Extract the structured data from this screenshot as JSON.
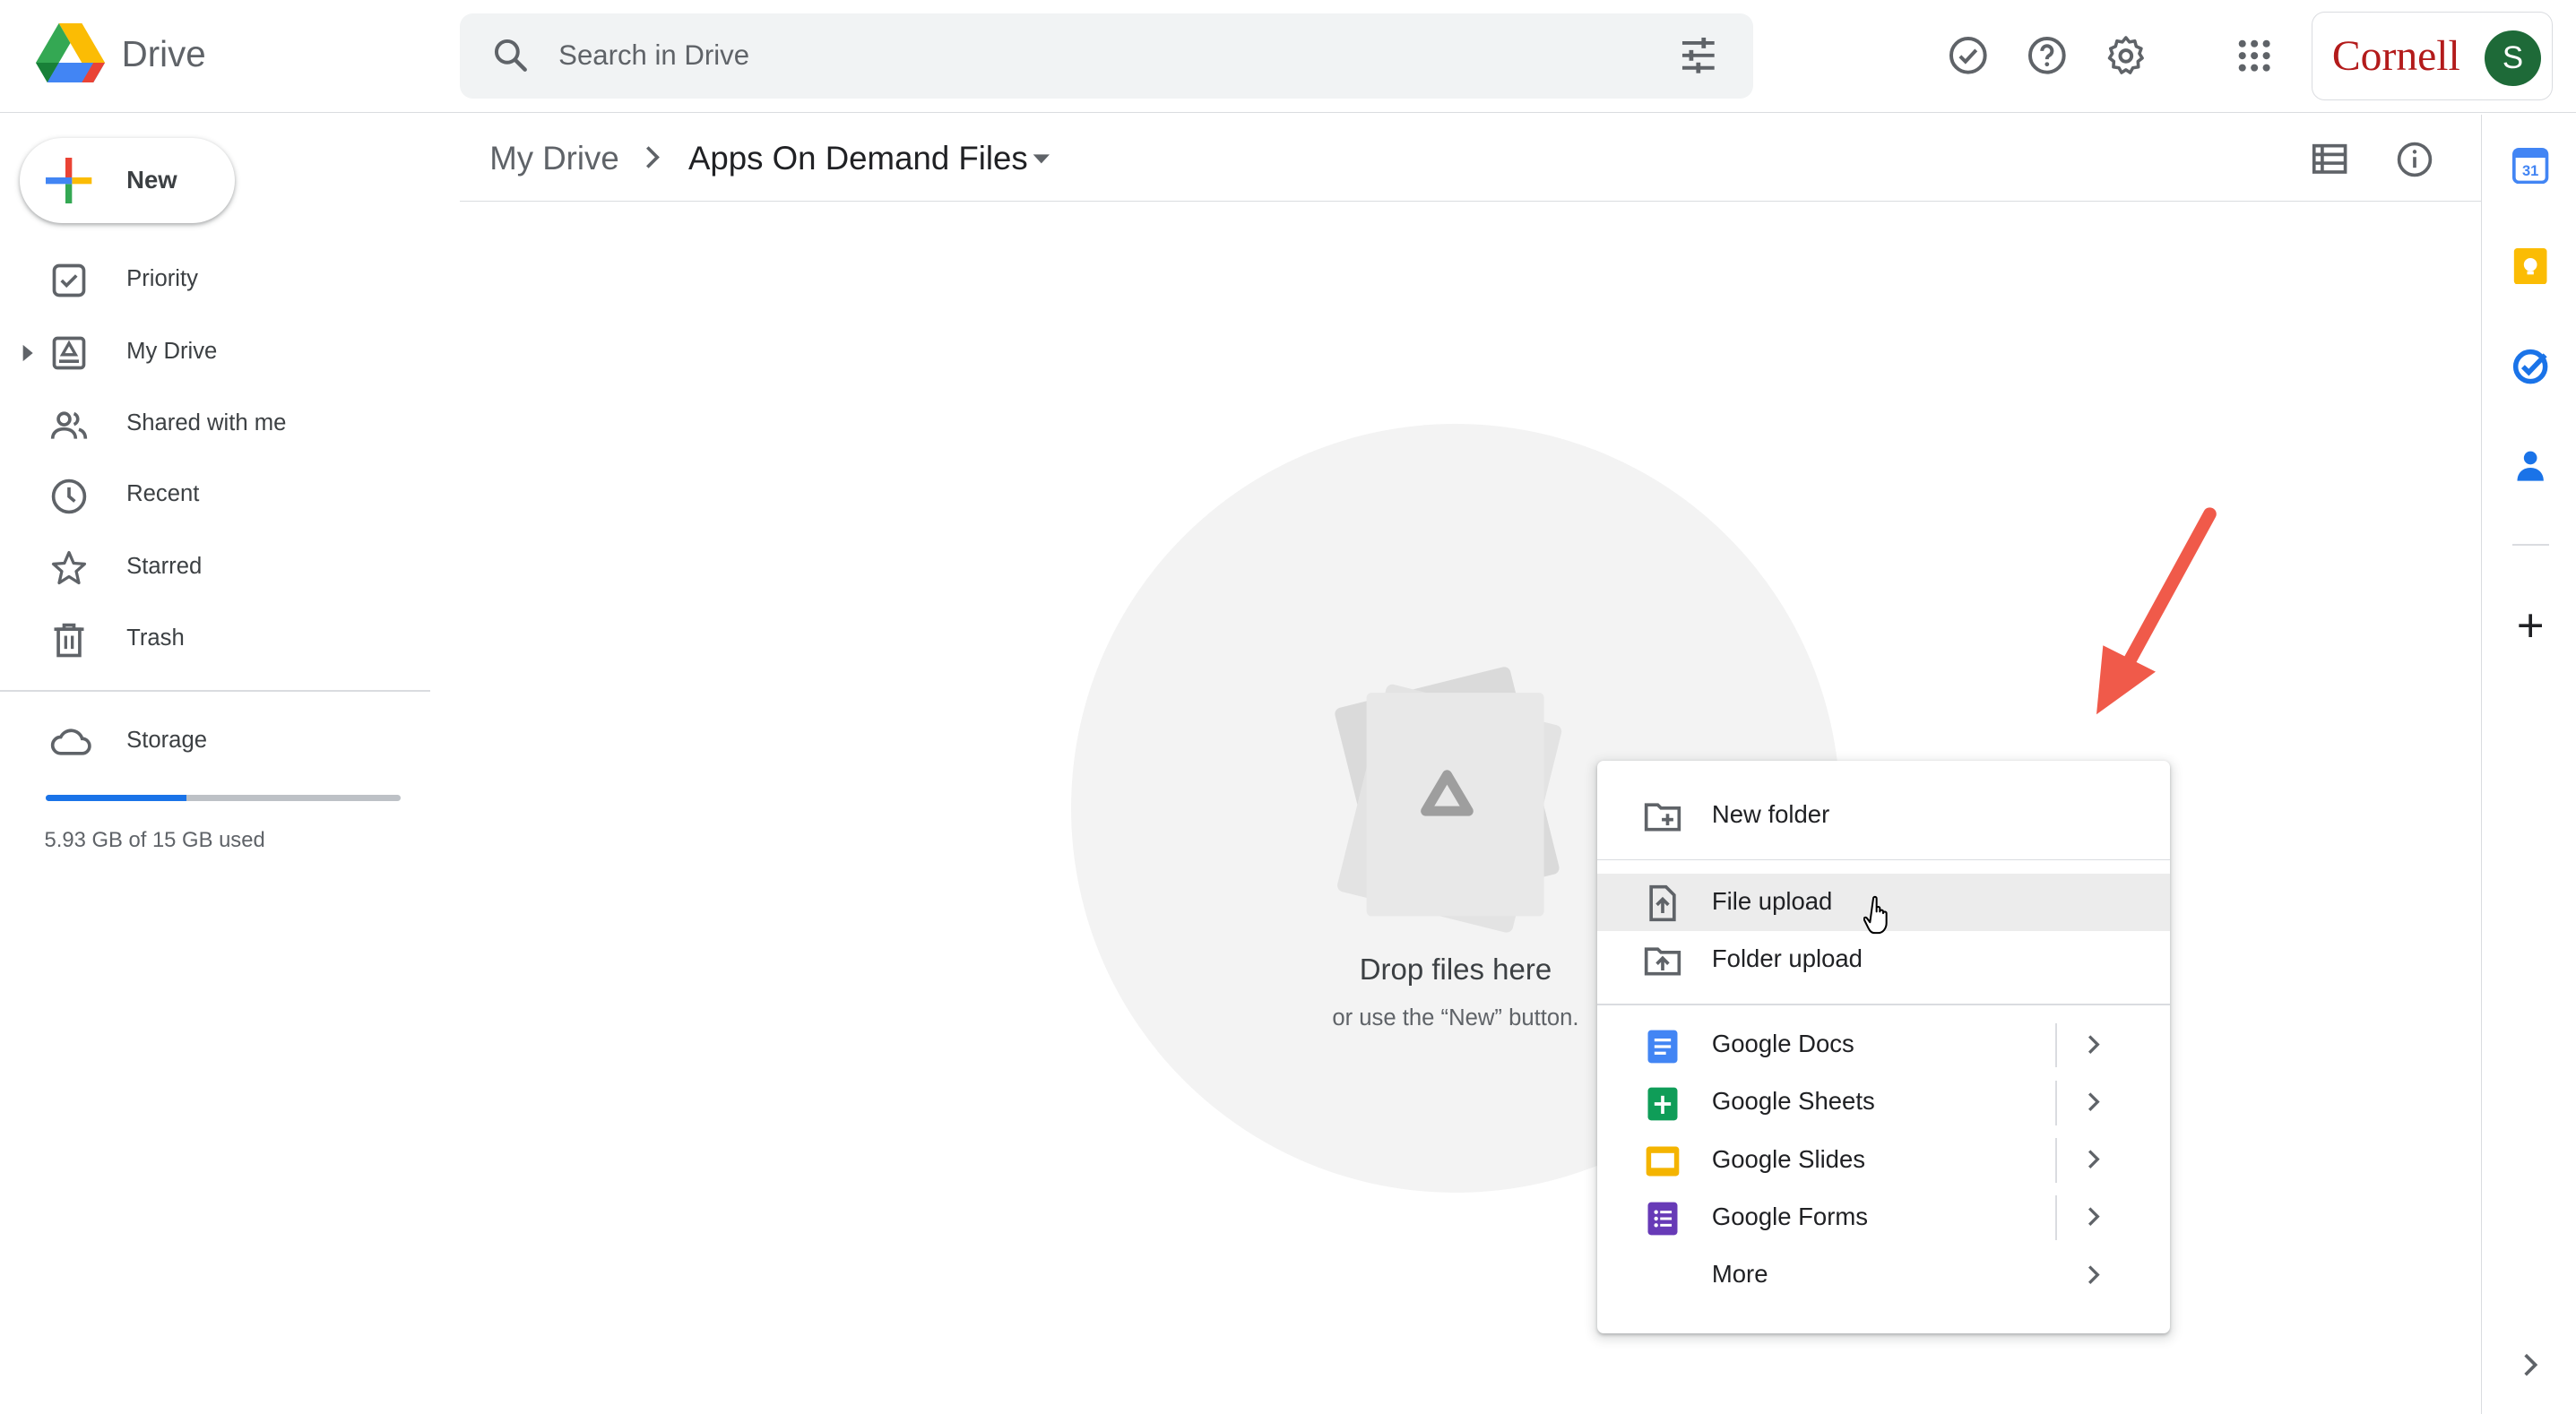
{
  "header": {
    "app_name": "Drive",
    "search_placeholder": "Search in Drive",
    "org_name": "Cornell",
    "avatar_initial": "S"
  },
  "sidebar": {
    "new_label": "New",
    "items": [
      {
        "label": "Priority",
        "icon": "priority-icon"
      },
      {
        "label": "My Drive",
        "icon": "my-drive-icon"
      },
      {
        "label": "Shared with me",
        "icon": "people-icon"
      },
      {
        "label": "Recent",
        "icon": "clock-icon"
      },
      {
        "label": "Starred",
        "icon": "star-icon"
      },
      {
        "label": "Trash",
        "icon": "trash-icon"
      }
    ],
    "storage": {
      "label": "Storage",
      "used_text": "5.93 GB of 15 GB used",
      "used_fraction": 0.395
    }
  },
  "breadcrumb": {
    "root": "My Drive",
    "current": "Apps On Demand Files"
  },
  "empty_state": {
    "title": "Drop files here",
    "subtitle": "or use the “New” button."
  },
  "new_menu": {
    "items": [
      {
        "label": "New folder",
        "icon": "new-folder-icon"
      },
      {
        "label": "File upload",
        "icon": "file-upload-icon"
      },
      {
        "label": "Folder upload",
        "icon": "folder-upload-icon"
      },
      {
        "label": "Google Docs",
        "icon": "google-docs-icon"
      },
      {
        "label": "Google Sheets",
        "icon": "google-sheets-icon"
      },
      {
        "label": "Google Slides",
        "icon": "google-slides-icon"
      },
      {
        "label": "Google Forms",
        "icon": "google-forms-icon"
      },
      {
        "label": "More",
        "icon": ""
      }
    ]
  },
  "colors": {
    "blue": "#1a73e8",
    "red": "#ea4335",
    "yellow": "#fbbc04",
    "green": "#34a853",
    "cornell_red": "#b31b1b",
    "avatar_green": "#1e6a38",
    "annotation_arrow": "#f05a4a"
  }
}
